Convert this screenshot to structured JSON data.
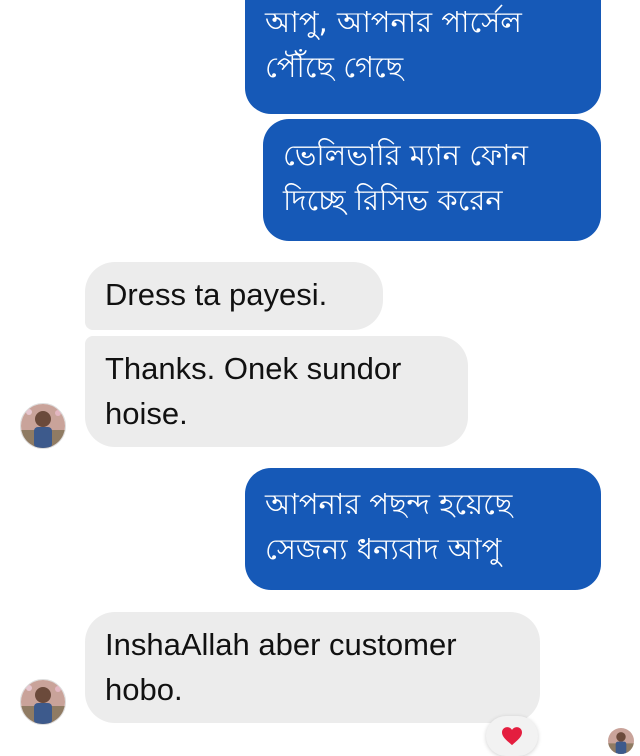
{
  "chat": {
    "messages": [
      {
        "direction": "outgoing",
        "text": "আপু, আপনার পার্সেল\nপৌঁছে গেছে"
      },
      {
        "direction": "outgoing",
        "text": "ভেলিভারি ম্যান ফোন\nদিচ্ছে রিসিভ করেন"
      },
      {
        "direction": "incoming",
        "text": "Dress ta payesi."
      },
      {
        "direction": "incoming",
        "text": "Thanks. Onek sundor\nhoise."
      },
      {
        "direction": "outgoing",
        "text": "আপনার পছন্দ হয়েছে\nসেজন্য ধন্যবাদ আপু"
      },
      {
        "direction": "incoming",
        "text": "InshaAllah aber customer\nhobo."
      }
    ],
    "reaction": {
      "icon": "heart-icon",
      "color": "#e41e3f"
    },
    "colors": {
      "outgoing_bubble": "#1659b7",
      "incoming_bubble": "#ececec",
      "background": "#ffffff"
    }
  }
}
